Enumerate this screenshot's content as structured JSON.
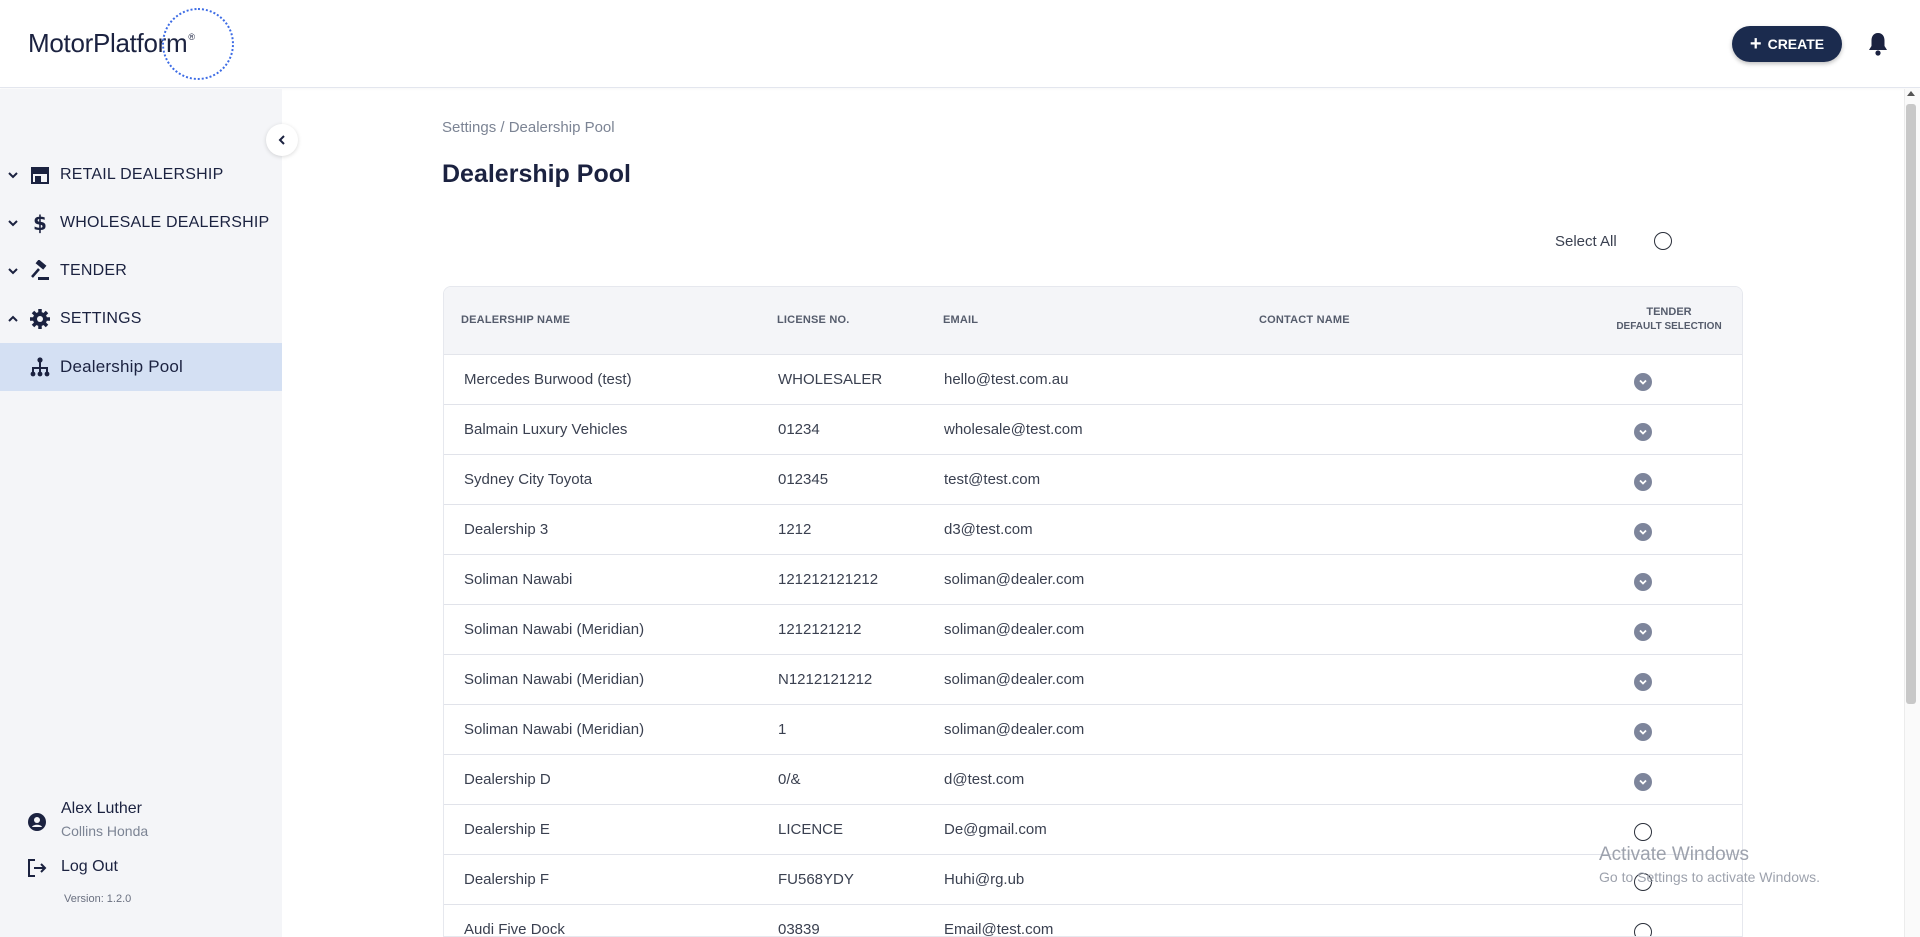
{
  "header": {
    "logo_text": "MotorPlatform",
    "create_label": "CREATE",
    "accent_color": "#3d6ce5",
    "brand_dark": "#1b2b4e"
  },
  "sidebar": {
    "items": [
      {
        "label": "RETAIL DEALERSHIP",
        "icon": "store-icon",
        "expanded": false
      },
      {
        "label": "WHOLESALE DEALERSHIP",
        "icon": "dollar-icon",
        "expanded": false
      },
      {
        "label": "TENDER",
        "icon": "gavel-icon",
        "expanded": false
      },
      {
        "label": "SETTINGS",
        "icon": "gear-icon",
        "expanded": true
      },
      {
        "label": "Dealership Pool",
        "icon": "hierarchy-icon",
        "active": true
      }
    ],
    "user": {
      "name": "Alex Luther",
      "organization": "Collins Honda"
    },
    "logout_label": "Log Out",
    "version": "Version: 1.2.0"
  },
  "main": {
    "breadcrumb": "Settings / Dealership Pool",
    "title": "Dealership Pool",
    "select_all_label": "Select All",
    "table": {
      "headers": {
        "name": "DEALERSHIP NAME",
        "license": "LICENSE NO.",
        "email": "EMAIL",
        "contact": "CONTACT NAME",
        "tender": "TENDER",
        "tender_sub": "DEFAULT SELECTION"
      },
      "rows": [
        {
          "name": "Mercedes Burwood (test)",
          "license": "WHOLESALER",
          "email": "hello@test.com.au",
          "contact": "",
          "selected": true
        },
        {
          "name": "Balmain Luxury Vehicles",
          "license": "01234",
          "email": "wholesale@test.com",
          "contact": "",
          "selected": true
        },
        {
          "name": "Sydney City Toyota",
          "license": "012345",
          "email": "test@test.com",
          "contact": "",
          "selected": true
        },
        {
          "name": "Dealership 3",
          "license": "1212",
          "email": "d3@test.com",
          "contact": "",
          "selected": true
        },
        {
          "name": "Soliman Nawabi",
          "license": "121212121212",
          "email": "soliman@dealer.com",
          "contact": "",
          "selected": true
        },
        {
          "name": "Soliman Nawabi (Meridian)",
          "license": "1212121212",
          "email": "soliman@dealer.com",
          "contact": "",
          "selected": true
        },
        {
          "name": "Soliman Nawabi (Meridian)",
          "license": "N1212121212",
          "email": "soliman@dealer.com",
          "contact": "",
          "selected": true
        },
        {
          "name": "Soliman Nawabi (Meridian)",
          "license": "1",
          "email": "soliman@dealer.com",
          "contact": "",
          "selected": true
        },
        {
          "name": "Dealership D",
          "license": "0/&",
          "email": "d@test.com",
          "contact": "",
          "selected": true
        },
        {
          "name": "Dealership E",
          "license": "LICENCE",
          "email": "De@gmail.com",
          "contact": "",
          "selected": false
        },
        {
          "name": "Dealership F",
          "license": "FU568YDY",
          "email": "Huhi@rg.ub",
          "contact": "",
          "selected": false
        },
        {
          "name": "Audi Five Dock",
          "license": "03839",
          "email": "Email@test.com",
          "contact": "",
          "selected": false
        }
      ]
    }
  },
  "watermark": {
    "line1": "Activate Windows",
    "line2": "Go to Settings to activate Windows."
  }
}
